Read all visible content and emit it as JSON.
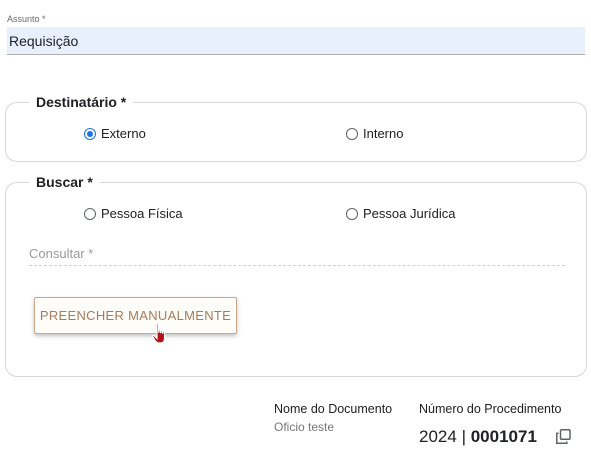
{
  "assunto": {
    "label": "Assunto *",
    "value": "Requisição"
  },
  "destinatario": {
    "legend": "Destinatário *",
    "options": [
      {
        "label": "Externo",
        "checked": true
      },
      {
        "label": "Interno",
        "checked": false
      }
    ]
  },
  "buscar": {
    "legend": "Buscar *",
    "options": [
      {
        "label": "Pessoa Física",
        "checked": false
      },
      {
        "label": "Pessoa Jurídica",
        "checked": false
      }
    ],
    "consultar_placeholder": "Consultar *",
    "manual_button": "PREENCHER MANUALMENTE"
  },
  "documento": {
    "name_label": "Nome do Documento",
    "name_value": "Oficio teste",
    "procedimento_label": "Número do Procedimento",
    "procedimento_year": "2024",
    "procedimento_separator": "|",
    "procedimento_number": "0001071"
  },
  "colors": {
    "accent": "#1a73e8",
    "button_text": "#a67b5b",
    "field_bg": "#e8f0fe"
  },
  "icons": {
    "copy": "copy-icon",
    "cursor": "hand-pointer-icon"
  }
}
